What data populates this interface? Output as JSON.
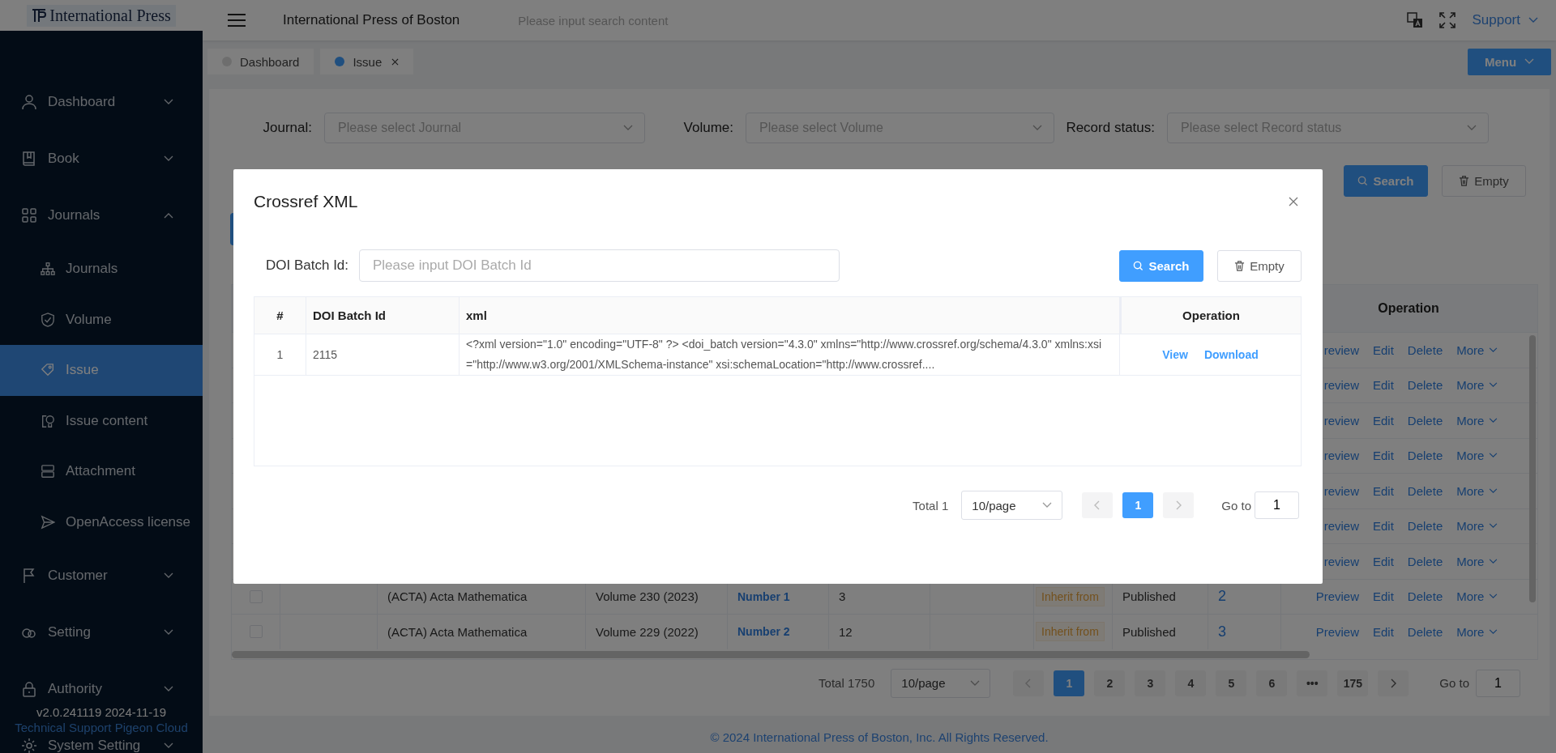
{
  "sidebar": {
    "logo": "International Press",
    "items": [
      {
        "label": "Dashboard",
        "expanded": false,
        "selected": false
      },
      {
        "label": "Book",
        "expanded": false,
        "selected": false
      },
      {
        "label": "Journals",
        "expanded": true,
        "selected": false,
        "children": [
          {
            "label": "Journals",
            "selected": false
          },
          {
            "label": "Volume",
            "selected": false
          },
          {
            "label": "Issue",
            "selected": true
          },
          {
            "label": "Issue content",
            "selected": false
          },
          {
            "label": "Attachment",
            "selected": false
          },
          {
            "label": "OpenAccess license",
            "selected": false
          }
        ]
      },
      {
        "label": "Customer",
        "expanded": false,
        "selected": false
      },
      {
        "label": "Setting",
        "expanded": false,
        "selected": false
      },
      {
        "label": "Authority",
        "expanded": false,
        "selected": false
      },
      {
        "label": "System Setting",
        "expanded": false,
        "selected": false
      }
    ],
    "version": "v2.0.241119 2024-11-19",
    "support": "Technical Support Pigeon Cloud"
  },
  "header": {
    "title": "International Press of Boston",
    "search": {
      "placeholder": "Please input search content"
    },
    "user": "Support"
  },
  "tabs": [
    {
      "label": "Dashboard",
      "selected": false,
      "closable": false
    },
    {
      "label": "Issue",
      "selected": true,
      "closable": true
    }
  ],
  "menu_button": "Menu",
  "filters": [
    {
      "label": "Journal:",
      "placeholder": "Please select Journal"
    },
    {
      "label": "Volume:",
      "placeholder": "Please select Volume"
    },
    {
      "label": "Record status:",
      "placeholder": "Please select Record status"
    }
  ],
  "filter_buttons": [
    {
      "label": "Search",
      "kind": "primary"
    },
    {
      "label": "Empty",
      "kind": "default"
    }
  ],
  "table": {
    "operation_header": "Operation",
    "rows": [
      {
        "actions": [
          "review",
          "Edit",
          "Delete",
          "More"
        ]
      },
      {
        "actions": [
          "review",
          "Edit",
          "Delete",
          "More"
        ]
      },
      {
        "actions": [
          "review",
          "Edit",
          "Delete",
          "More"
        ]
      },
      {
        "actions": [
          "review",
          "Edit",
          "Delete",
          "More"
        ]
      },
      {
        "actions": [
          "review",
          "Edit",
          "Delete",
          "More"
        ]
      },
      {
        "actions": [
          "review",
          "Edit",
          "Delete",
          "More"
        ]
      },
      {
        "actions": [
          "review",
          "Edit",
          "Delete",
          "More"
        ]
      },
      {
        "checked": false,
        "journal": "(ACTA) Acta Mathematica",
        "volume": "Volume 230 (2023)",
        "issue": "Number 1",
        "count": "3",
        "tag": "Inherit from",
        "status": "Published",
        "number": "2",
        "actions": [
          "Preview",
          "Edit",
          "Delete",
          "More"
        ]
      },
      {
        "checked": false,
        "journal": "(ACTA) Acta Mathematica",
        "volume": "Volume 229 (2022)",
        "issue": "Number 2",
        "count": "12",
        "tag": "Inherit from",
        "status": "Published",
        "number": "3",
        "actions": [
          "Preview",
          "Edit",
          "Delete",
          "More"
        ]
      }
    ]
  },
  "pagination": {
    "total": "Total 1750",
    "page_size": "10/page",
    "pages": [
      {
        "label": "1",
        "selected": true
      },
      {
        "label": "2",
        "selected": false
      },
      {
        "label": "3",
        "selected": false
      },
      {
        "label": "4",
        "selected": false
      },
      {
        "label": "5",
        "selected": false
      },
      {
        "label": "6",
        "selected": false
      },
      {
        "label": "•••",
        "selected": false
      },
      {
        "label": "175",
        "selected": false
      }
    ],
    "goto_label": "Go to",
    "goto_value": "1"
  },
  "footer": "© 2024 International Press of Boston, Inc. All Rights Reserved.",
  "dialog": {
    "title": "Crossref XML",
    "field": {
      "label": "DOI Batch Id:",
      "placeholder": "Please input DOI Batch Id"
    },
    "buttons": [
      {
        "label": "Search",
        "kind": "primary"
      },
      {
        "label": "Empty",
        "kind": "default"
      }
    ],
    "columns": [
      "#",
      "DOI Batch Id",
      "xml",
      "Operation"
    ],
    "rows": [
      {
        "index": "1",
        "batch_id": "2115",
        "xml": "<?xml version=\"1.0\" encoding=\"UTF-8\" ?> <doi_batch version=\"4.3.0\" xmlns=\"http://www.crossref.org/schema/4.3.0\" xmlns:xsi=\"http://www.w3.org/2001/XMLSchema-instance\" xsi:schemaLocation=\"http://www.crossref....",
        "actions": [
          "View",
          "Download"
        ]
      }
    ],
    "pagination": {
      "total": "Total 1",
      "page_size": "10/page",
      "pages": [
        {
          "label": "1",
          "selected": true
        }
      ],
      "goto_label": "Go to",
      "goto_value": "1"
    }
  }
}
